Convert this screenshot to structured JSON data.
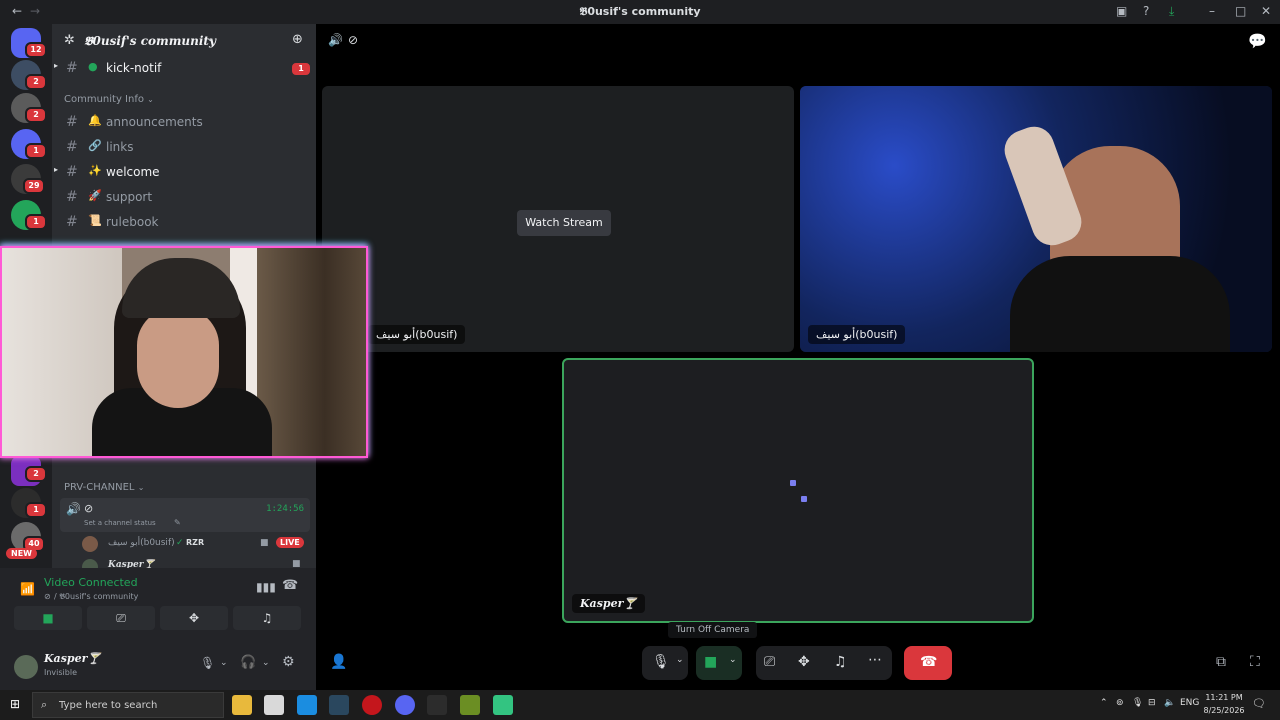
{
  "window": {
    "title": "𝕭0usif's community",
    "back_icon": "←",
    "forward_icon": "→"
  },
  "rail": {
    "badges": [
      "12",
      "2",
      "2",
      "1",
      "29",
      "1",
      "2",
      "1",
      "40"
    ],
    "new_label": "NEW"
  },
  "sidebar": {
    "guild_name": "𝕭0usif's community",
    "channels_top": [
      {
        "name": "kick-notif",
        "badge": "1"
      }
    ],
    "category": "Community Info",
    "channels": [
      {
        "name": "announcements"
      },
      {
        "name": "links"
      },
      {
        "name": "welcome"
      },
      {
        "name": "support"
      },
      {
        "name": "rulebook"
      }
    ],
    "voice_category": "PRV-CHANNEL",
    "voice_timer": "1:24:56",
    "voice_status_hint": "Set a channel status",
    "voice_member_1": "أبو سيف(b0usif)",
    "voice_member_1_tag": "RZR",
    "live_badge": "LIVE",
    "voice_member_2": "𝑲𝒂𝒔𝒑𝒆𝒓🍸",
    "connection_status": "Video Connected",
    "connection_channel": "/ 𝕭0usif's community",
    "user_name": "𝑲𝒂𝒔𝒑𝒆𝒓🍸",
    "user_status": "Invisible"
  },
  "stage": {
    "tile1_label": "أبو سيف(b0usif)",
    "watch_stream": "Watch Stream",
    "tile2_label": "أبو سيف(b0usif)",
    "tile3_label": "𝑲𝒂𝒔𝒑𝒆𝒓🍸",
    "tooltip": "Turn Off Camera"
  },
  "taskbar": {
    "search_placeholder": "Type here to search",
    "lang": "ENG",
    "time": "11:21 PM",
    "date": "8/25/2026"
  }
}
